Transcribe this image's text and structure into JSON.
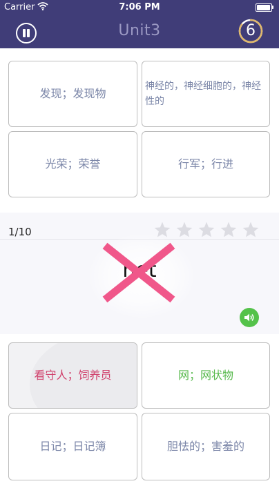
{
  "status_bar": {
    "carrier": "Carrier",
    "time": "7:06 PM"
  },
  "header": {
    "title": "Unit3",
    "timer_value": "6",
    "timer_progress": 0.85,
    "colors": {
      "background": "#403d78",
      "timer_ring": "#e0b86a"
    }
  },
  "top_options": [
    {
      "label": "发现；发现物"
    },
    {
      "label": "神经的，神经细胞的，神经性的"
    },
    {
      "label": "光荣；荣誉"
    },
    {
      "label": "行军；行进"
    }
  ],
  "quiz": {
    "progress": "1/10",
    "stars_total": 5,
    "stars_filled": 0,
    "word": "net",
    "result": "wrong",
    "colors": {
      "wrong_mark": "#f0578a",
      "sound_button": "#54c24a"
    }
  },
  "answer_options": [
    {
      "label": "看守人；饲养员",
      "state": "wrong-selected",
      "color": "#d0416c"
    },
    {
      "label": "网；网状物",
      "state": "correct",
      "color": "#57b94c"
    },
    {
      "label": "日记；日记簿",
      "state": "normal"
    },
    {
      "label": "胆怯的；害羞的",
      "state": "normal"
    }
  ]
}
